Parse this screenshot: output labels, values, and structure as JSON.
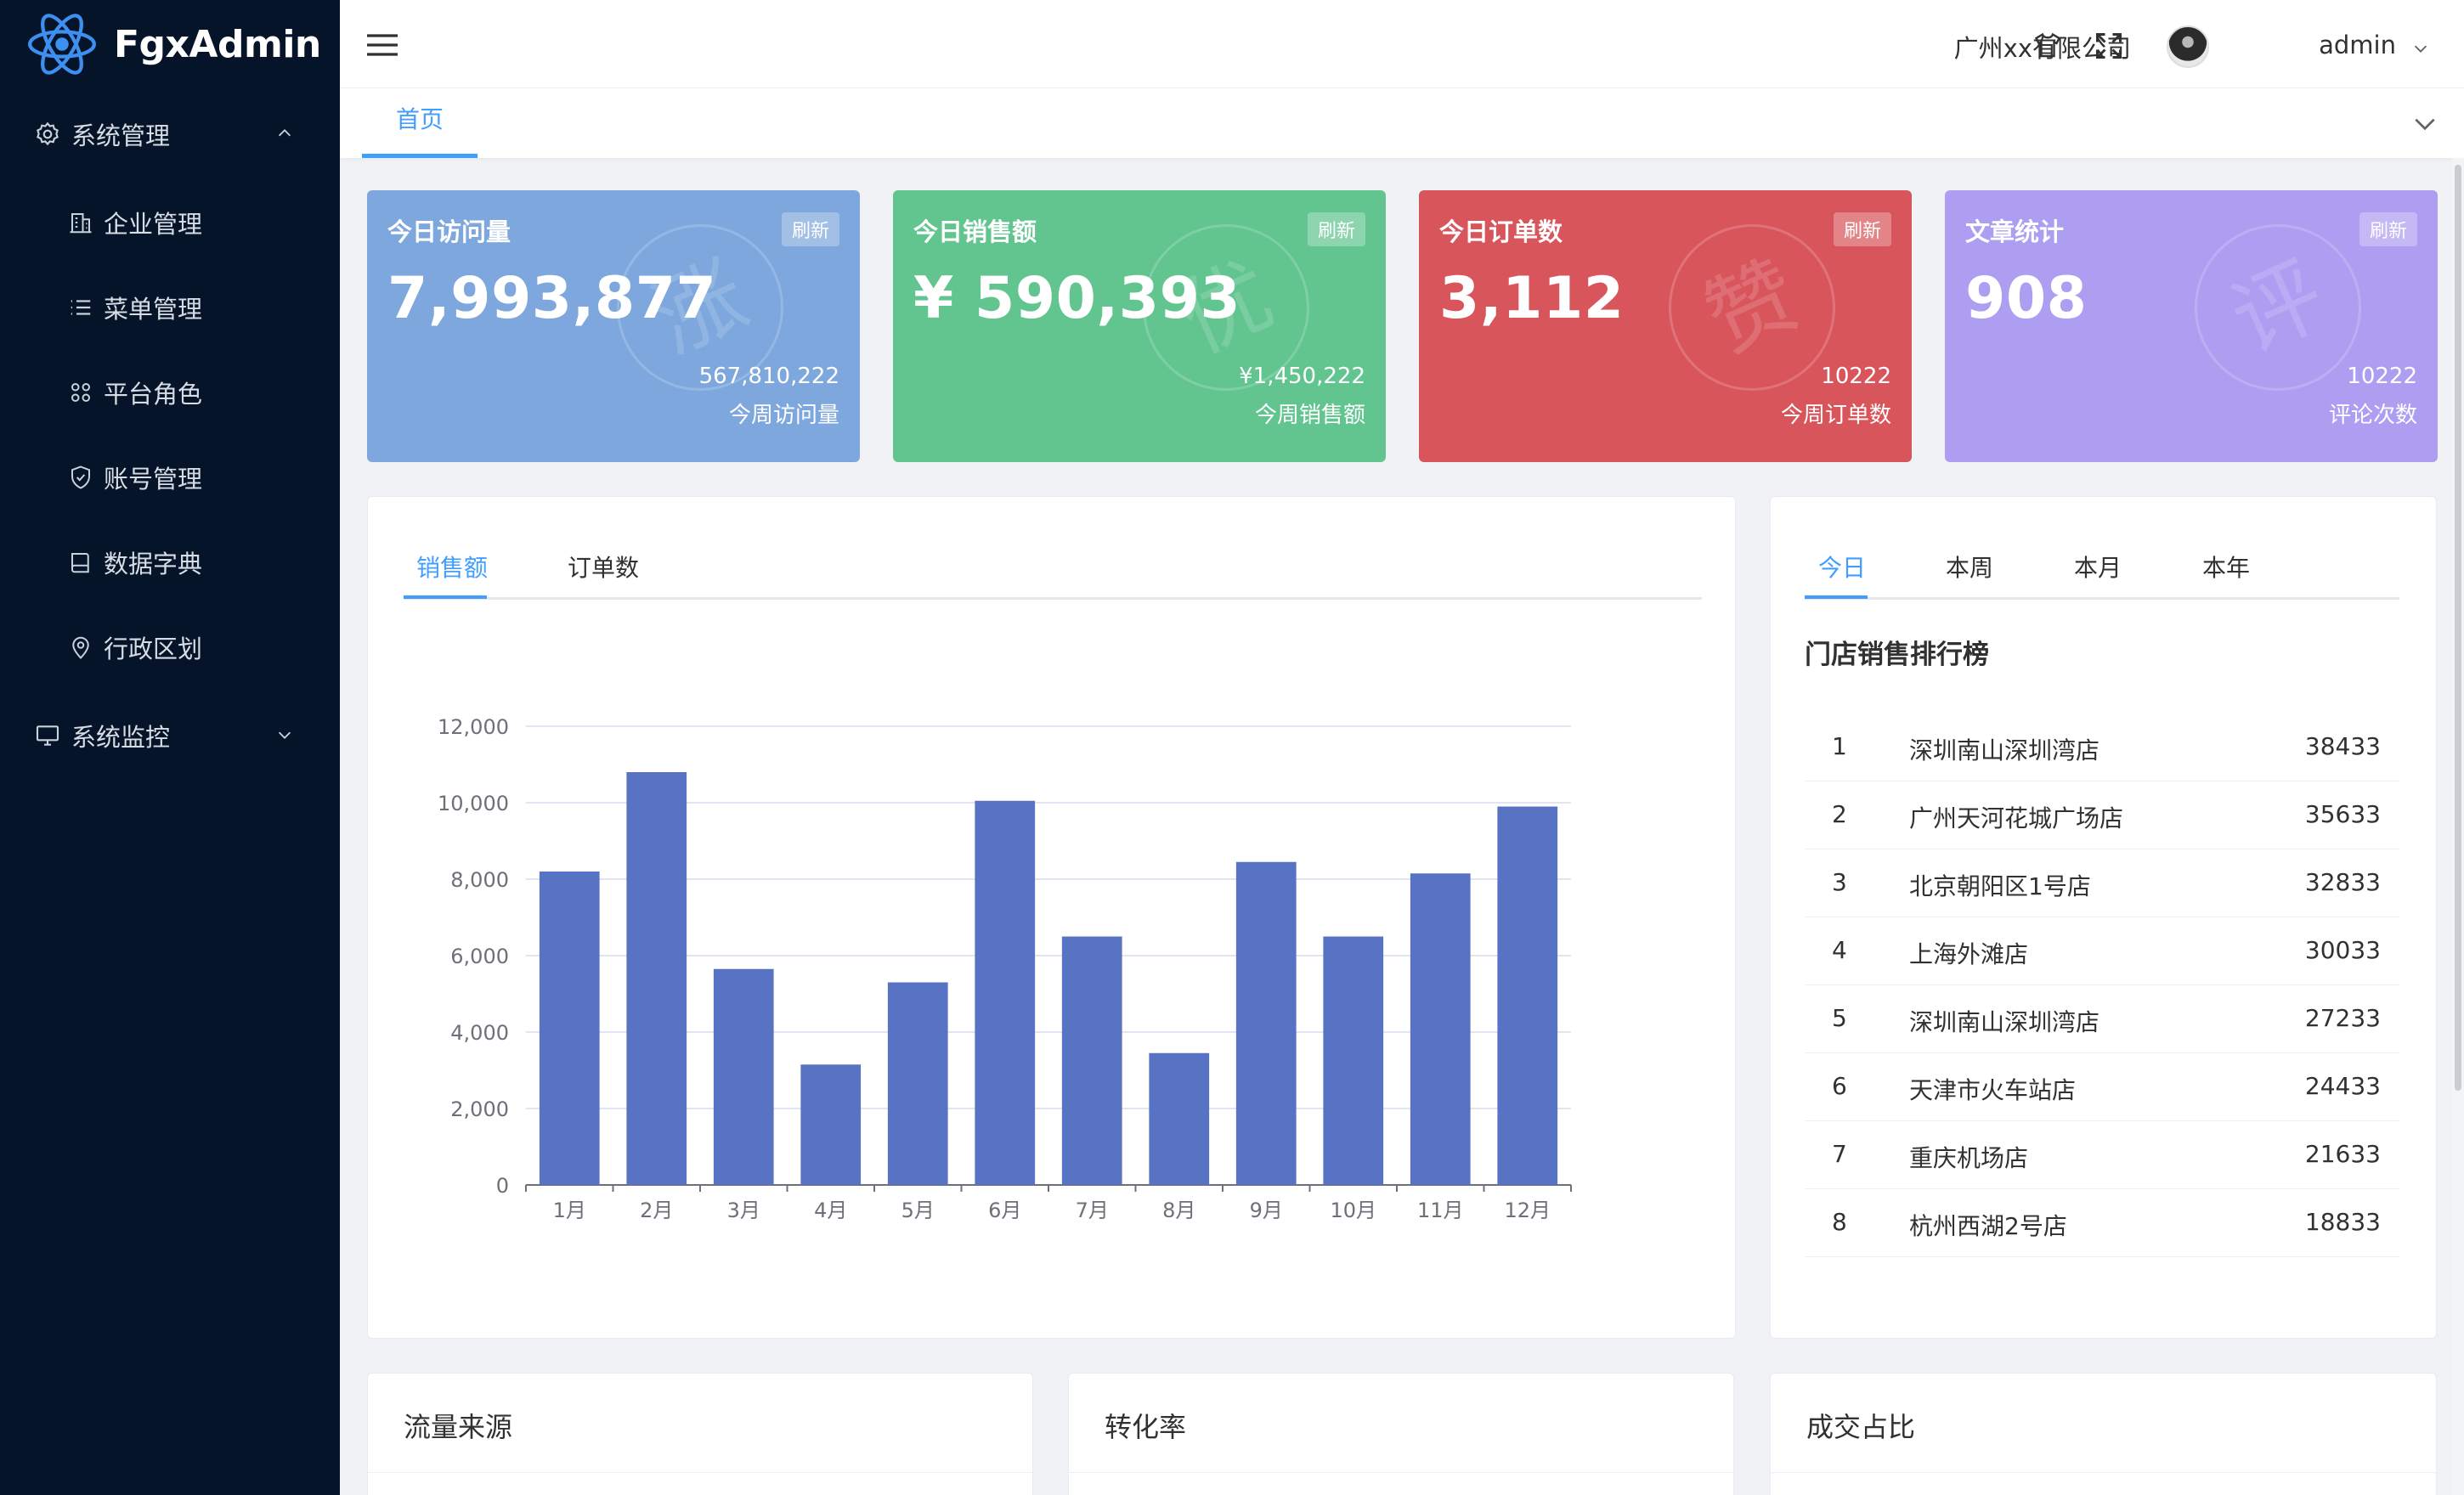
{
  "app": {
    "name": "FgxAdmin"
  },
  "sidebar": {
    "groups": [
      {
        "label": "系统管理",
        "icon": "gear-icon",
        "expanded": true,
        "items": [
          {
            "label": "企业管理",
            "icon": "building-icon"
          },
          {
            "label": "菜单管理",
            "icon": "list-icon"
          },
          {
            "label": "平台角色",
            "icon": "grid-icon"
          },
          {
            "label": "账号管理",
            "icon": "shield-icon"
          },
          {
            "label": "数据字典",
            "icon": "book-icon"
          },
          {
            "label": "行政区划",
            "icon": "location-icon"
          }
        ]
      },
      {
        "label": "系统监控",
        "icon": "monitor-icon",
        "expanded": false,
        "items": []
      }
    ]
  },
  "header": {
    "company": "广州xx有限公司",
    "username": "admin",
    "icons": [
      "menu-toggle-icon",
      "shirt-icon",
      "fullscreen-icon",
      "chevron-down-icon"
    ]
  },
  "page_tabs": [
    "首页"
  ],
  "stats": [
    {
      "label": "今日访问量",
      "value": "7,993,877",
      "refresh": "刷新",
      "sub_value": "567,810,222",
      "sub_label": "今周访问量",
      "badge": "涨",
      "color": "#7ea8dd"
    },
    {
      "label": "今日销售额",
      "value": "¥ 590,393",
      "refresh": "刷新",
      "sub_value": "¥1,450,222",
      "sub_label": "今周销售额",
      "badge": "优",
      "color": "#62c590"
    },
    {
      "label": "今日订单数",
      "value": "3,112",
      "refresh": "刷新",
      "sub_value": "10222",
      "sub_label": "今周订单数",
      "badge": "赞",
      "color": "#d9555c"
    },
    {
      "label": "文章统计",
      "value": "908",
      "refresh": "刷新",
      "sub_value": "10222",
      "sub_label": "评论次数",
      "badge": "评",
      "color": "#ad9ef2"
    }
  ],
  "sales_panel": {
    "tabs": [
      "销售额",
      "订单数"
    ],
    "active_tab": 0
  },
  "chart_data": {
    "type": "bar",
    "categories": [
      "1月",
      "2月",
      "3月",
      "4月",
      "5月",
      "6月",
      "7月",
      "8月",
      "9月",
      "10月",
      "11月",
      "12月"
    ],
    "values": [
      8200,
      10800,
      5650,
      3150,
      5300,
      10050,
      6500,
      3450,
      8450,
      6500,
      8150,
      9900
    ],
    "ylim": [
      0,
      12000
    ],
    "yticks": [
      "0",
      "2,000",
      "4,000",
      "6,000",
      "8,000",
      "10,000",
      "12,000"
    ],
    "ytick_values": [
      0,
      2000,
      4000,
      6000,
      8000,
      10000,
      12000
    ],
    "color": "#5873c3",
    "grid": true
  },
  "ranking_panel": {
    "tabs": [
      "今日",
      "本周",
      "本月",
      "本年"
    ],
    "active_tab": 0,
    "title": "门店销售排行榜",
    "rows": [
      {
        "no": "1",
        "name": "深圳南山深圳湾店",
        "value": "38433"
      },
      {
        "no": "2",
        "name": "广州天河花城广场店",
        "value": "35633"
      },
      {
        "no": "3",
        "name": "北京朝阳区1号店",
        "value": "32833"
      },
      {
        "no": "4",
        "name": "上海外滩店",
        "value": "30033"
      },
      {
        "no": "5",
        "name": "深圳南山深圳湾店",
        "value": "27233"
      },
      {
        "no": "6",
        "name": "天津市火车站店",
        "value": "24433"
      },
      {
        "no": "7",
        "name": "重庆机场店",
        "value": "21633"
      },
      {
        "no": "8",
        "name": "杭州西湖2号店",
        "value": "18833"
      }
    ]
  },
  "bottom_panels": [
    "流量来源",
    "转化率",
    "成交占比"
  ]
}
